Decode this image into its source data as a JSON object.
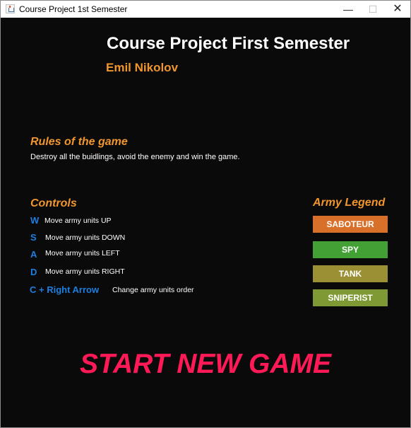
{
  "window": {
    "title": "Course Project 1st Semester",
    "minimize_glyph": "—",
    "maximize_glyph": "☐",
    "close_glyph": "✕"
  },
  "header": {
    "title": "Course Project First Semester",
    "author": "Emil Nikolov"
  },
  "rules": {
    "heading": "Rules of the game",
    "text": "Destroy all the buidlings, avoid the enemy and win the game."
  },
  "controls": {
    "heading": "Controls",
    "items": [
      {
        "key": "W",
        "desc": "Move army units UP"
      },
      {
        "key": "S",
        "desc": "Move army units DOWN"
      },
      {
        "key": "A",
        "desc": "Move army units LEFT"
      },
      {
        "key": "D",
        "desc": "Move army units RIGHT"
      },
      {
        "key": "C + Right Arrow",
        "desc": "Change army units order"
      }
    ]
  },
  "legend": {
    "heading": "Army Legend",
    "units": [
      {
        "label": "SABOTEUR",
        "color": "#d9702a"
      },
      {
        "label": "SPY",
        "color": "#42a034"
      },
      {
        "label": "TANK",
        "color": "#9c9034"
      },
      {
        "label": "SNIPERIST",
        "color": "#7f9a34"
      }
    ]
  },
  "start": {
    "label": "START NEW GAME"
  },
  "colors": {
    "background": "#0a0a0a",
    "accent": "#f0962d",
    "key": "#1d7fe0",
    "start": "#ff1a57"
  }
}
